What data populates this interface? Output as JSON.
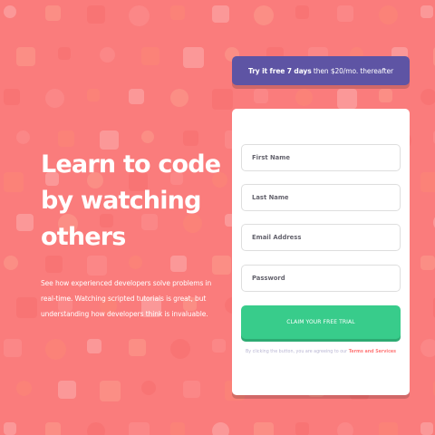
{
  "colors": {
    "background": "#fa7c7c",
    "promo_bar": "#5e54a4",
    "cta": "#38cc8b",
    "link": "#ff7a7a",
    "card": "#ffffff"
  },
  "hero": {
    "title": "Learn to code by watching others",
    "text": "See how experienced developers solve problems in real-time. Watching scripted tutorials is great, but understanding how developers think is invaluable."
  },
  "promo": {
    "bold": "Try it free 7 days",
    "rest": " then $20/mo. thereafter"
  },
  "form": {
    "first_name_placeholder": "First Name",
    "last_name_placeholder": "Last Name",
    "email_placeholder": "Email Address",
    "password_placeholder": "Password",
    "submit_label": "CLAIM YOUR FREE TRIAL",
    "terms_prefix": "By clicking the button, you are agreeing to our ",
    "terms_link": "Terms and Services"
  }
}
